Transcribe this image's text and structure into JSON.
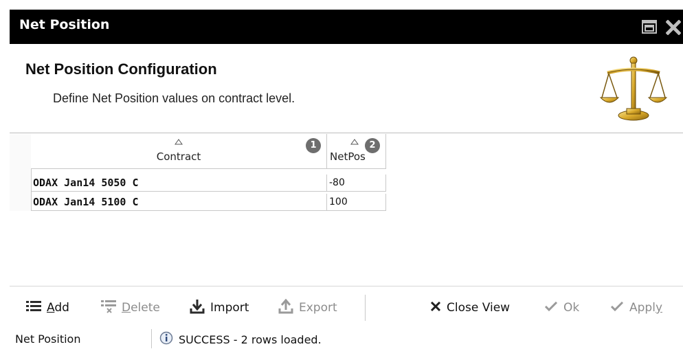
{
  "window": {
    "title": "Net Position"
  },
  "header": {
    "title": "Net Position Configuration",
    "subtitle": "Define Net Position values on contract level."
  },
  "grid": {
    "columns": [
      {
        "label": "Contract",
        "sort_index": "1"
      },
      {
        "label": "NetPos",
        "sort_index": "2"
      }
    ],
    "rows": [
      {
        "contract": "ODAX Jan14 5050 C",
        "netpos": "-80"
      },
      {
        "contract": "ODAX Jan14 5100 C",
        "netpos": "100"
      }
    ]
  },
  "toolbar": {
    "add_prefix": "",
    "add_underlined": "A",
    "add_rest": "dd",
    "delete_underlined": "D",
    "delete_rest": "elete",
    "import_label": "Import",
    "export_label": "Export",
    "close_view_label": "Close View",
    "ok_label": "Ok",
    "apply_main": "Appl",
    "apply_underlined": "y"
  },
  "status": {
    "view_name": "Net Position",
    "message": "SUCCESS - 2 rows loaded."
  },
  "icons": {
    "restore": "restore-window-icon",
    "close": "close-window-icon",
    "scales": "balance-scales-icon",
    "add": "add-list-icon",
    "delete": "delete-list-icon",
    "import": "import-download-icon",
    "export": "export-upload-icon",
    "close_view": "x-icon",
    "ok": "checkmark-icon",
    "apply": "checkmark-icon",
    "info": "info-icon"
  },
  "colors": {
    "titlebar": "#000000",
    "badge": "#6e6e6e",
    "disabled_text": "#8c8c8c"
  }
}
